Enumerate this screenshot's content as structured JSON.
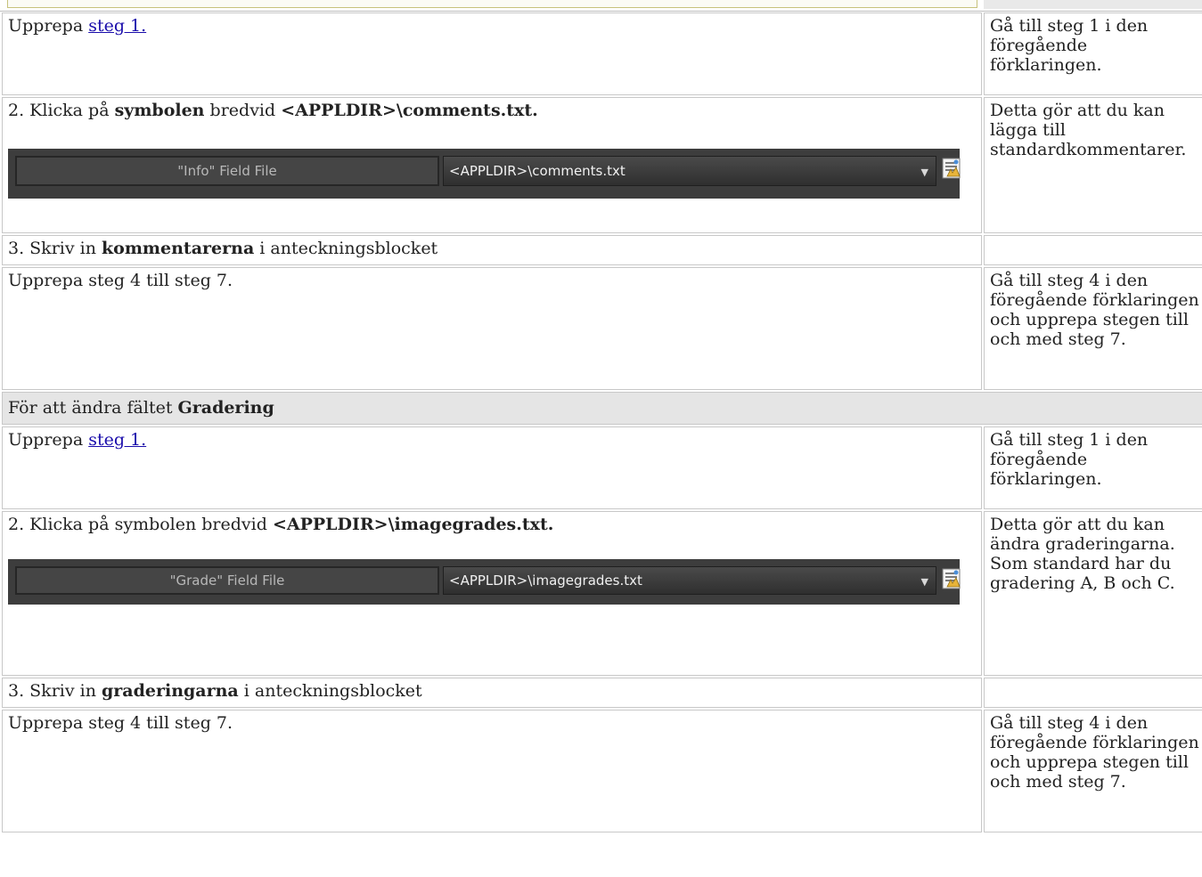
{
  "rows": {
    "r1": {
      "prefix": "Upprepa ",
      "link": "steg 1.",
      "note": "Gå till steg 1 i den föregående förklaringen."
    },
    "r2": {
      "prefix": "2. Klicka på ",
      "bold1": "symbolen",
      "mid": " bredvid ",
      "bold2": "<APPLDIR>\\comments.txt.",
      "note": "Detta gör att du kan lägga till standardkommentarer."
    },
    "r2_widget": {
      "label": "\"Info\" Field File",
      "value": "<APPLDIR>\\comments.txt"
    },
    "r3": {
      "prefix": "3. Skriv in ",
      "bold": "kommentarerna",
      "suffix": " i anteckningsblocket"
    },
    "r4": {
      "text": "Upprepa steg 4 till steg 7.",
      "note": "Gå till steg 4 i den föregående förklaringen och upprepa stegen till och med steg 7."
    },
    "section": {
      "prefix": "För att ändra fältet ",
      "bold": "Gradering"
    },
    "r5": {
      "prefix": "Upprepa ",
      "link": "steg 1.",
      "note": "Gå till steg 1 i den föregående förklaringen."
    },
    "r6": {
      "prefix": "2. Klicka på symbolen bredvid ",
      "bold": "<APPLDIR>\\imagegrades.txt.",
      "note": "Detta gör att du kan ändra graderingarna. Som standard har du gradering A, B och C."
    },
    "r6_widget": {
      "label": "\"Grade\" Field File",
      "value": "<APPLDIR>\\imagegrades.txt"
    },
    "r7": {
      "prefix": "3. Skriv in ",
      "bold": "graderingarna",
      "suffix": " i anteckningsblocket"
    },
    "r8": {
      "text": "Upprepa steg 4 till steg 7.",
      "note": "Gå till steg 4 i den föregående förklaringen och upprepa stegen till och med steg 7."
    }
  },
  "icons": {
    "file_browse": "file-browse-icon",
    "dropdown": "chevron-down-icon"
  },
  "colors": {
    "link": "#1a0dab",
    "section_bg": "#e5e5e5",
    "widget_bg": "#3d3d3d"
  }
}
